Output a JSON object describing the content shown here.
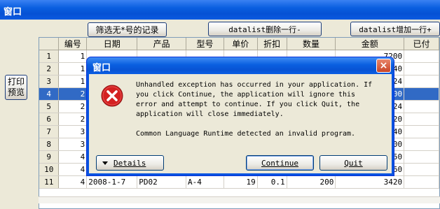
{
  "main_window": {
    "title": "窗口",
    "filter_button": "筛选无*号的记录",
    "delete_row_button": "datalist删除一行-",
    "add_row_button": "datalist增加一行+",
    "print_button": "打印预览"
  },
  "grid": {
    "columns": [
      "编号",
      "日期",
      "产品",
      "型号",
      "单价",
      "折扣",
      "数量",
      "金额",
      "已付"
    ],
    "row_headers": [
      "1",
      "2",
      "3",
      "4",
      "5",
      "6",
      "7",
      "8",
      "9",
      "10",
      "11"
    ],
    "rows": [
      [
        "1",
        "",
        "",
        "",
        "",
        "",
        "",
        "7200",
        ""
      ],
      [
        "1",
        "",
        "",
        "",
        "",
        "",
        "",
        "5440",
        ""
      ],
      [
        "1",
        "",
        "",
        "",
        "",
        "",
        "",
        "1224",
        ""
      ],
      [
        "2",
        "",
        "",
        "",
        "",
        "",
        "",
        "4900",
        ""
      ],
      [
        "2",
        "",
        "",
        "",
        "",
        "",
        "",
        "4224",
        ""
      ],
      [
        "2",
        "",
        "",
        "",
        "",
        "",
        "",
        "2720",
        ""
      ],
      [
        "3",
        "",
        "",
        "",
        "",
        "",
        "",
        "6840",
        ""
      ],
      [
        "3",
        "",
        "",
        "",
        "",
        "",
        "",
        "2400",
        ""
      ],
      [
        "4",
        "",
        "",
        "",
        "",
        "",
        "",
        "0450",
        ""
      ],
      [
        "4",
        "",
        "",
        "",
        "",
        "",
        "",
        "660",
        ""
      ],
      [
        "4",
        "2008-1-7",
        "PD02",
        "A-4",
        "19",
        "0.1",
        "200",
        "3420",
        ""
      ]
    ],
    "selected_row": 4
  },
  "dialog": {
    "title": "窗口",
    "close_glyph": "×",
    "message": "Unhandled exception has occurred in your application. If\nyou click Continue, the application will ignore this\nerror and attempt to continue. If you click Quit, the\napplication will close immediately.\n\nCommon Language Runtime detected an invalid program.",
    "details_button": "Details",
    "continue_button": "Continue",
    "quit_button": "Quit",
    "icon": "error-icon"
  },
  "colors": {
    "titlebar": "#0a5fe0",
    "selection": "#316ac5",
    "error_red": "#d42121"
  }
}
